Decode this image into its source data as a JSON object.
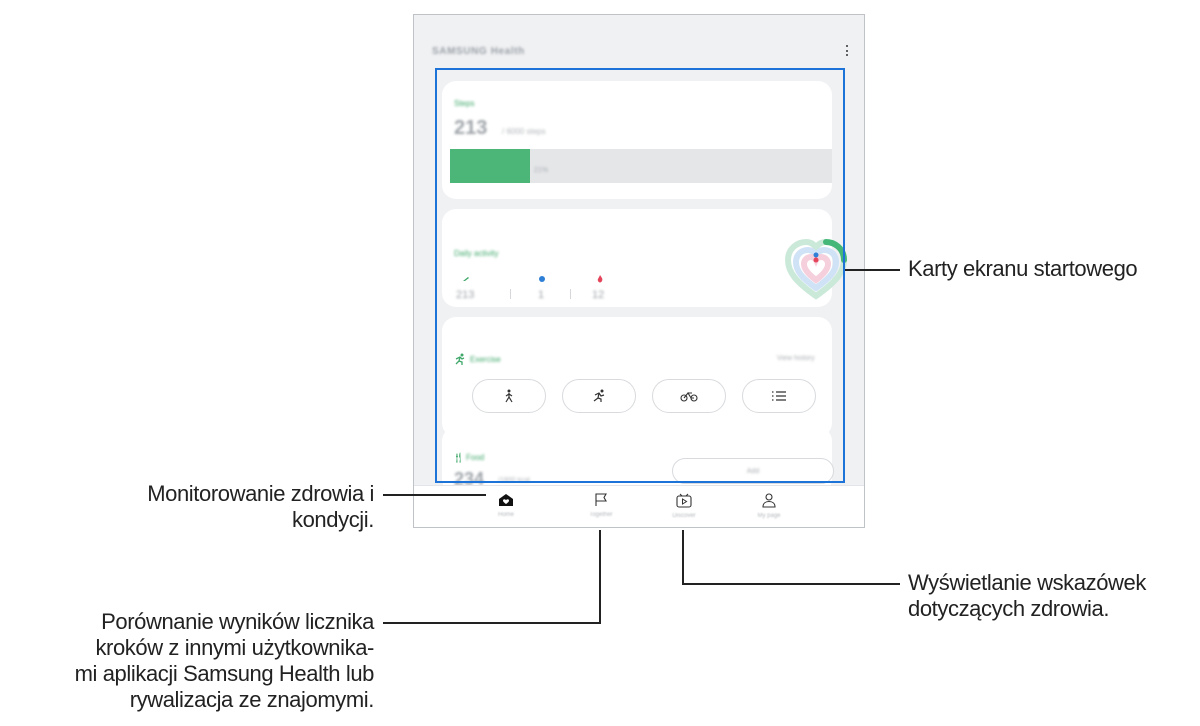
{
  "app": {
    "title": "SAMSUNG Health",
    "steps": {
      "label": "Steps",
      "count": "213",
      "target": "/ 6000 steps",
      "progress_fraction": 0.21,
      "progress_text": "21%"
    },
    "daily_activity": {
      "label": "Daily activity",
      "items": [
        {
          "icon": "walk-icon",
          "value": "213"
        },
        {
          "icon": "clock-icon",
          "value": "1"
        },
        {
          "icon": "flame-icon",
          "value": "12"
        }
      ]
    },
    "exercise": {
      "label": "Exercise",
      "history": "View history",
      "buttons": [
        "walking-icon",
        "running-icon",
        "cycling-icon",
        "list-icon"
      ]
    },
    "food": {
      "label": "Food",
      "count": "234",
      "unit": "/1800 kcal",
      "add_label": "Add"
    },
    "nav": [
      {
        "icon": "home-icon",
        "label": "Home"
      },
      {
        "icon": "flag-icon",
        "label": "Together"
      },
      {
        "icon": "discover-icon",
        "label": "Discover"
      },
      {
        "icon": "profile-icon",
        "label": "My page"
      }
    ]
  },
  "callouts": {
    "home_cards": [
      "Karty ekranu startowego"
    ],
    "monitoring": [
      "Monitorowanie zdrowia i",
      "kondycji."
    ],
    "together": [
      "Porównanie wyników licznika",
      "kroków z innymi użytkownika-",
      "mi aplikacji Samsung Health lub",
      "rywalizacja ze znajomymi."
    ],
    "discover": [
      "Wyświetlanie wskazówek",
      "dotyczących zdrowia."
    ]
  },
  "colors": {
    "accent_green": "#4bb677",
    "highlight_blue": "#1e73d8"
  }
}
